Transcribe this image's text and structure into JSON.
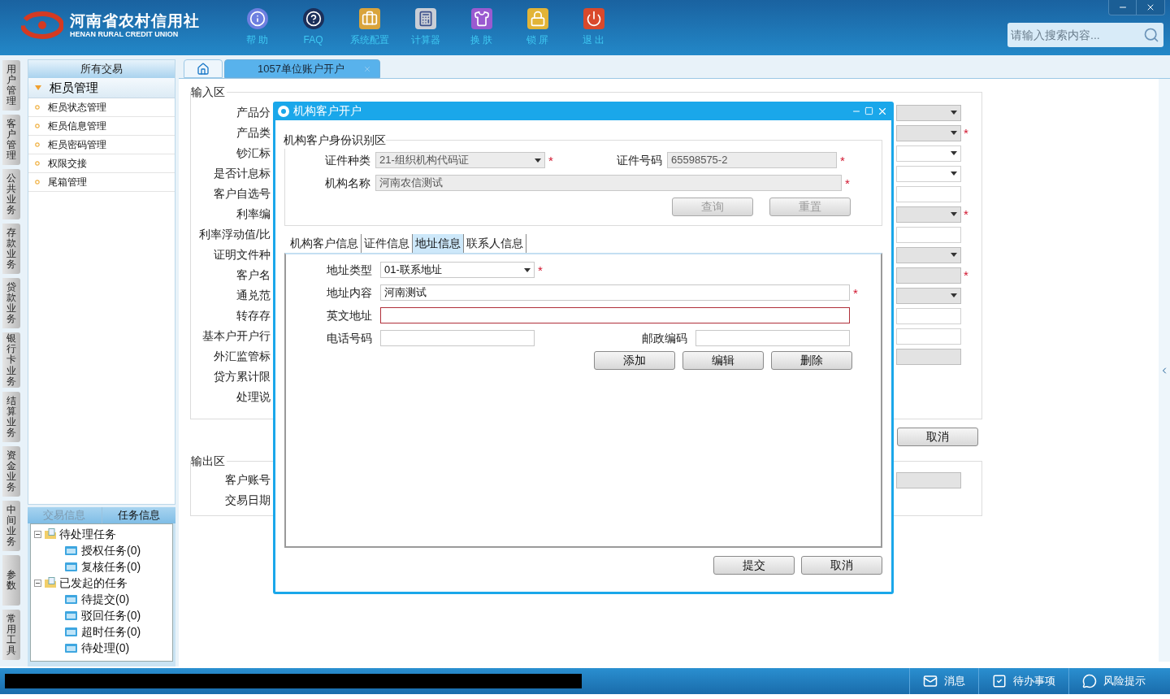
{
  "header": {
    "logo_cn": "河南省农村信用社",
    "logo_en": "HENAN RURAL CREDIT UNION",
    "toolbar": [
      {
        "kind": "info",
        "label": "帮 助"
      },
      {
        "kind": "faq",
        "label": "FAQ"
      },
      {
        "kind": "config",
        "label": "系统配置"
      },
      {
        "kind": "calculator",
        "label": "计算器"
      },
      {
        "kind": "skin",
        "label": "换 肤"
      },
      {
        "kind": "lock",
        "label": "锁 屏"
      },
      {
        "kind": "exit",
        "label": "退 出"
      }
    ],
    "search": {
      "placeholder": "请输入搜索内容..."
    }
  },
  "left_nav": [
    "用户管理",
    "客户管理",
    "公共业务",
    "存款业务",
    "贷款业务",
    "银行卡业务",
    "结算业务",
    "资金业务",
    "中间业务",
    "参数",
    "常用工具"
  ],
  "sidebar": {
    "title": "所有交易",
    "group": {
      "label": "柜员管理",
      "expanded": true,
      "items": [
        "柜员状态管理",
        "柜员信息管理",
        "柜员密码管理",
        "权限交接",
        "尾箱管理"
      ]
    },
    "bottom_tabs": [
      {
        "label": "交易信息",
        "selected": false
      },
      {
        "label": "任务信息",
        "selected": true
      }
    ],
    "tree": [
      {
        "label": "待处理任务",
        "expanded": true,
        "children": [
          {
            "label": "授权任务(0)"
          },
          {
            "label": "复核任务(0)"
          }
        ]
      },
      {
        "label": "已发起的任务",
        "expanded": true,
        "children": [
          {
            "label": "待提交(0)"
          },
          {
            "label": "驳回任务(0)"
          },
          {
            "label": "超时任务(0)"
          },
          {
            "label": "待处理(0)"
          }
        ]
      }
    ]
  },
  "content": {
    "tabs": [
      {
        "kind": "home",
        "selected": false
      },
      {
        "kind": "page",
        "label": "1057单位账户开户",
        "selected": true
      }
    ],
    "input_section": {
      "title": "输入区",
      "rows": [
        {
          "label": "产品分",
          "field": {
            "kind": "select",
            "disabled": true
          }
        },
        {
          "label": "产品类",
          "field": {
            "kind": "select",
            "disabled": true,
            "required_mark": "*"
          }
        },
        {
          "label": "钞汇标",
          "field": {
            "kind": "select",
            "disabled": false
          }
        },
        {
          "label": "是否计息标",
          "field": {
            "kind": "select",
            "disabled": false
          }
        },
        {
          "label": "客户自选号",
          "field": {
            "kind": "input",
            "disabled": false
          }
        },
        {
          "label": "利率编",
          "field": {
            "kind": "select",
            "disabled": true,
            "required_mark": "*"
          }
        },
        {
          "label": "利率浮动值/比",
          "field": {
            "kind": "input",
            "disabled": false
          }
        },
        {
          "label": "证明文件种",
          "field": {
            "kind": "select",
            "disabled": true
          }
        },
        {
          "label": "客户名",
          "field": {
            "kind": "input",
            "disabled": true,
            "required_mark": "*"
          }
        },
        {
          "label": "通兑范",
          "field": {
            "kind": "select",
            "disabled": true
          }
        },
        {
          "label": "转存存",
          "field": {
            "kind": "input",
            "disabled": false
          }
        },
        {
          "label": "基本户开户行",
          "field": {
            "kind": "input",
            "disabled": false
          }
        },
        {
          "label": "外汇监管标",
          "field": {
            "kind": "input",
            "disabled": true
          }
        },
        {
          "label": "贷方累计限"
        },
        {
          "label": "处理说"
        }
      ]
    },
    "cancel_button": "取消",
    "output_section": {
      "title": "输出区",
      "rows": [
        {
          "label": "客户账号",
          "field": {
            "kind": "input",
            "disabled": true
          }
        },
        {
          "label": "交易日期"
        }
      ]
    }
  },
  "dialog": {
    "title": "机构客户开户",
    "identity": {
      "title": "机构客户身份识别区",
      "rows": [
        [
          {
            "label": "证件种类",
            "kind": "select",
            "value": "21-组织机构代码证",
            "disabled": true,
            "required_mark": "*",
            "error": false
          },
          {
            "label": "证件号码",
            "kind": "input",
            "value": "65598575-2",
            "disabled": true,
            "required_mark": "*",
            "error": false
          }
        ],
        [
          {
            "label": "机构名称",
            "kind": "input",
            "value": "河南农信测试",
            "disabled": true,
            "required_mark": "*",
            "error": false
          }
        ]
      ],
      "buttons": [
        {
          "label": "查询",
          "disabled": true
        },
        {
          "label": "重置",
          "disabled": true
        }
      ]
    },
    "tabs": [
      {
        "label": "机构客户信息",
        "selected": false
      },
      {
        "label": "证件信息",
        "selected": false
      },
      {
        "label": "地址信息",
        "selected": true
      },
      {
        "label": "联系人信息",
        "selected": false
      }
    ],
    "address": {
      "rows": [
        [
          {
            "label": "地址类型",
            "kind": "select",
            "value": "01-联系地址",
            "disabled": false,
            "required_mark": "*",
            "error": false
          }
        ],
        [
          {
            "label": "地址内容",
            "kind": "input",
            "value": "河南测试",
            "disabled": false,
            "required_mark": "*",
            "error": false
          }
        ],
        [
          {
            "label": "英文地址",
            "kind": "input",
            "disabled": false,
            "error": true
          }
        ],
        [
          {
            "label": "电话号码",
            "kind": "input",
            "disabled": false,
            "error": false
          },
          {
            "label": "邮政编码",
            "kind": "input",
            "disabled": false,
            "error": false
          }
        ]
      ],
      "buttons": [
        {
          "label": "添加",
          "disabled": false
        },
        {
          "label": "编辑",
          "disabled": false
        },
        {
          "label": "删除",
          "disabled": false
        }
      ]
    },
    "footer_buttons": [
      {
        "label": "提交",
        "disabled": false
      },
      {
        "label": "取消",
        "disabled": false
      }
    ]
  },
  "status_bar": {
    "items": [
      {
        "kind": "message",
        "label": "消息"
      },
      {
        "kind": "todo",
        "label": "待办事项"
      },
      {
        "kind": "risk",
        "label": "风险提示"
      }
    ]
  }
}
